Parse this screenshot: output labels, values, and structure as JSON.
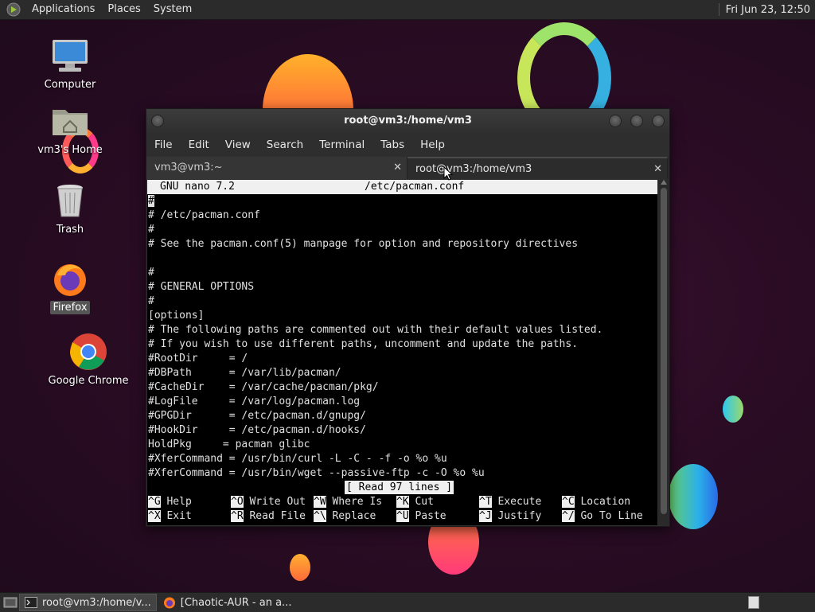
{
  "top_panel": {
    "menus": [
      "Applications",
      "Places",
      "System"
    ],
    "clock": "Fri Jun 23, 12:50"
  },
  "desktop_icons": [
    {
      "label": "Computer",
      "icon": "computer-icon"
    },
    {
      "label": "vm3's Home",
      "icon": "home-folder-icon"
    },
    {
      "label": "Trash",
      "icon": "trash-icon"
    },
    {
      "label": "Firefox",
      "icon": "firefox-icon",
      "selected": true
    },
    {
      "label": "Google Chrome",
      "icon": "chrome-icon"
    }
  ],
  "window": {
    "title": "root@vm3:/home/vm3",
    "menu": [
      "File",
      "Edit",
      "View",
      "Search",
      "Terminal",
      "Tabs",
      "Help"
    ],
    "tabs": [
      {
        "label": "vm3@vm3:~",
        "active": false
      },
      {
        "label": "root@vm3:/home/vm3",
        "active": true
      }
    ]
  },
  "nano": {
    "version": "GNU nano 7.2",
    "filename": "/etc/pacman.conf",
    "lines": [
      "#",
      "# /etc/pacman.conf",
      "#",
      "# See the pacman.conf(5) manpage for option and repository directives",
      "",
      "#",
      "# GENERAL OPTIONS",
      "#",
      "[options]",
      "# The following paths are commented out with their default values listed.",
      "# If you wish to use different paths, uncomment and update the paths.",
      "#RootDir     = /",
      "#DBPath      = /var/lib/pacman/",
      "#CacheDir    = /var/cache/pacman/pkg/",
      "#LogFile     = /var/log/pacman.log",
      "#GPGDir      = /etc/pacman.d/gnupg/",
      "#HookDir     = /etc/pacman.d/hooks/",
      "HoldPkg     = pacman glibc",
      "#XferCommand = /usr/bin/curl -L -C - -f -o %o %u",
      "#XferCommand = /usr/bin/wget --passive-ftp -c -O %o %u"
    ],
    "status": "[ Read 97 lines ]",
    "shortcuts_row1": [
      {
        "key": "^G",
        "label": "Help"
      },
      {
        "key": "^O",
        "label": "Write Out"
      },
      {
        "key": "^W",
        "label": "Where Is"
      },
      {
        "key": "^K",
        "label": "Cut"
      },
      {
        "key": "^T",
        "label": "Execute"
      },
      {
        "key": "^C",
        "label": "Location"
      }
    ],
    "shortcuts_row2": [
      {
        "key": "^X",
        "label": "Exit"
      },
      {
        "key": "^R",
        "label": "Read File"
      },
      {
        "key": "^\\",
        "label": "Replace"
      },
      {
        "key": "^U",
        "label": "Paste"
      },
      {
        "key": "^J",
        "label": "Justify"
      },
      {
        "key": "^/",
        "label": "Go To Line"
      }
    ]
  },
  "taskbar": {
    "tasks": [
      {
        "label": "root@vm3:/home/v...",
        "icon": "terminal-icon",
        "active": true
      },
      {
        "label": "[Chaotic-AUR - an a...",
        "icon": "firefox-icon",
        "active": false
      }
    ]
  }
}
